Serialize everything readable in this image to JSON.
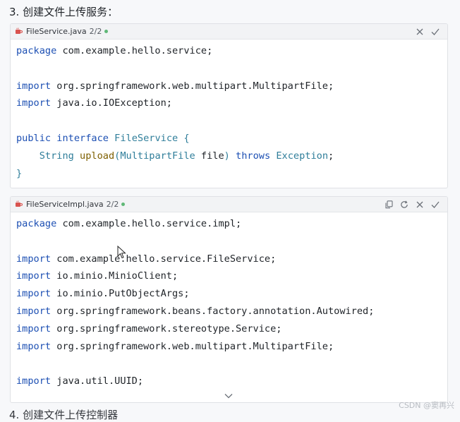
{
  "step_title": "3. 创建文件上传服务：",
  "next_title": "4. 创建文件上传控制器",
  "watermark": "CSDN @窦再兴",
  "colors": {
    "keyword": "#1c4fb3",
    "type": "#2f7e9a",
    "method": "#7d5f00",
    "status_dot": "#5fb877",
    "java_icon": "#d9534f"
  },
  "icons": {
    "file_icon": "java-cup-icon",
    "copy": "copy-icon",
    "refresh": "refresh-icon",
    "close": "close-icon",
    "accept": "check-icon",
    "expand": "chevron-down-icon"
  },
  "cards": [
    {
      "file_name": "FileService.java",
      "file_count": "2/2",
      "lines": [
        [
          {
            "t": "package",
            "c": "kw"
          },
          {
            "t": " com.example.hello.service;"
          }
        ],
        [],
        [
          {
            "t": "import",
            "c": "kw"
          },
          {
            "t": " org.springframework.web.multipart.MultipartFile;"
          }
        ],
        [
          {
            "t": "import",
            "c": "kw"
          },
          {
            "t": " java.io.IOException;"
          }
        ],
        [],
        [
          {
            "t": "public",
            "c": "kw"
          },
          {
            "t": " "
          },
          {
            "t": "interface",
            "c": "kw"
          },
          {
            "t": " "
          },
          {
            "t": "FileService",
            "c": "ty"
          },
          {
            "t": " {",
            "c": "ty"
          }
        ],
        [
          {
            "t": "    "
          },
          {
            "t": "String",
            "c": "ty"
          },
          {
            "t": " "
          },
          {
            "t": "upload",
            "c": "fn"
          },
          {
            "t": "(",
            "c": "ty"
          },
          {
            "t": "MultipartFile",
            "c": "ty"
          },
          {
            "t": " file"
          },
          {
            "t": ")",
            "c": "ty"
          },
          {
            "t": " "
          },
          {
            "t": "throws",
            "c": "kw"
          },
          {
            "t": " "
          },
          {
            "t": "Exception",
            "c": "ty"
          },
          {
            "t": ";"
          }
        ],
        [
          {
            "t": "}",
            "c": "ty"
          }
        ]
      ]
    },
    {
      "file_name": "FileServiceImpl.java",
      "file_count": "2/2",
      "lines": [
        [
          {
            "t": "package",
            "c": "kw"
          },
          {
            "t": " com.example.hello.service.impl;"
          }
        ],
        [],
        [
          {
            "t": "import",
            "c": "kw"
          },
          {
            "t": " com.example.hello.service.FileService;"
          }
        ],
        [
          {
            "t": "import",
            "c": "kw"
          },
          {
            "t": " io.minio.MinioClient;"
          }
        ],
        [
          {
            "t": "import",
            "c": "kw"
          },
          {
            "t": " io.minio.PutObjectArgs;"
          }
        ],
        [
          {
            "t": "import",
            "c": "kw"
          },
          {
            "t": " org.springframework.beans.factory.annotation.Autowired;"
          }
        ],
        [
          {
            "t": "import",
            "c": "kw"
          },
          {
            "t": " org.springframework.stereotype.Service;"
          }
        ],
        [
          {
            "t": "import",
            "c": "kw"
          },
          {
            "t": " org.springframework.web.multipart.MultipartFile;"
          }
        ],
        [],
        [
          {
            "t": "import",
            "c": "kw"
          },
          {
            "t": " java.util.UUID;"
          }
        ]
      ]
    }
  ]
}
